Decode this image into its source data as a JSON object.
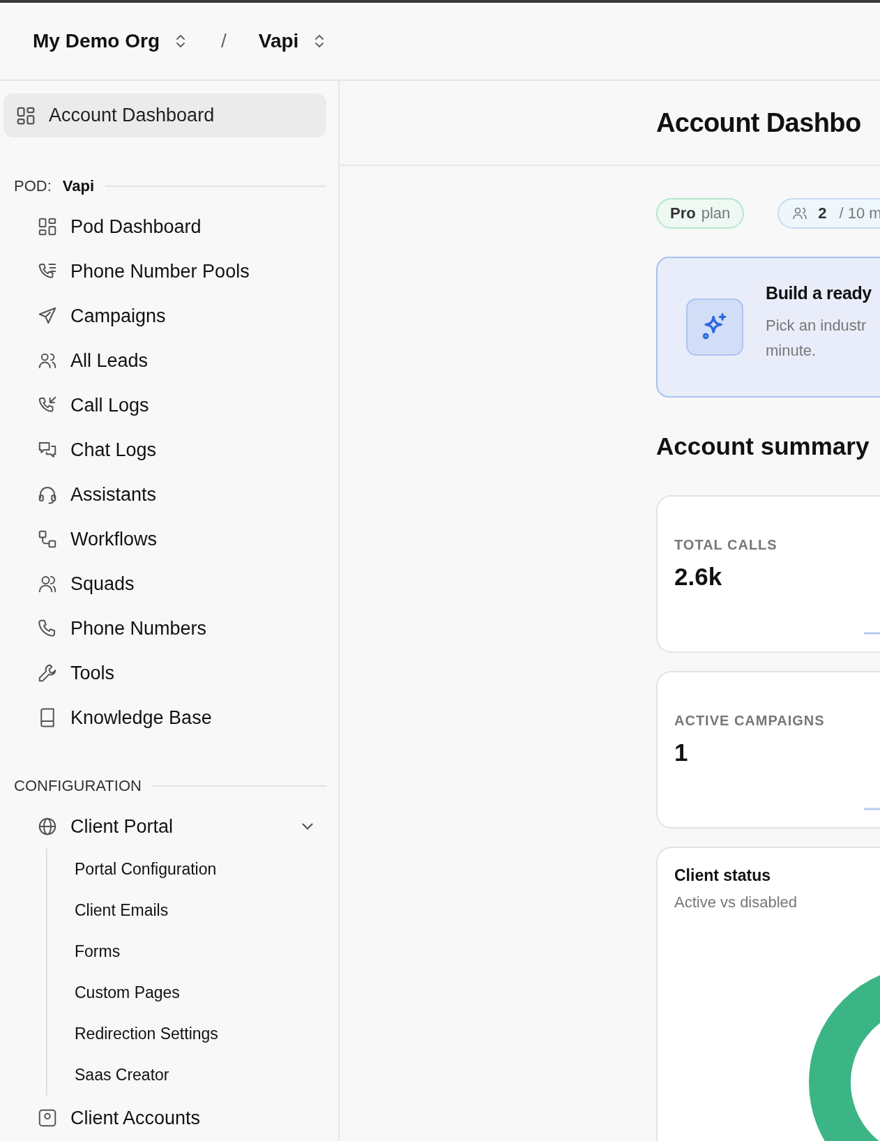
{
  "breadcrumb": {
    "org": "My Demo Org",
    "separator": "/",
    "project": "Vapi"
  },
  "sidebar": {
    "top_item": {
      "label": "Account Dashboard",
      "selected": true
    },
    "sections": [
      {
        "kind": "pod",
        "label": "POD:",
        "value": "Vapi",
        "items": [
          {
            "label": "Pod Dashboard",
            "selected": false
          },
          {
            "label": "Phone Number Pools",
            "selected": false
          },
          {
            "label": "Campaigns",
            "selected": false
          },
          {
            "label": "All Leads",
            "selected": false
          },
          {
            "label": "Call Logs",
            "selected": false
          },
          {
            "label": "Chat Logs",
            "selected": false
          },
          {
            "label": "Assistants",
            "selected": false
          },
          {
            "label": "Workflows",
            "selected": false
          },
          {
            "label": "Squads",
            "selected": false
          },
          {
            "label": "Phone Numbers",
            "selected": false
          },
          {
            "label": "Tools",
            "selected": false
          },
          {
            "label": "Knowledge Base",
            "selected": false
          }
        ]
      },
      {
        "kind": "plain",
        "label": "CONFIGURATION",
        "items": [
          {
            "label": "Client Portal",
            "selected": false,
            "expanded": true,
            "children": [
              {
                "label": "Portal Configuration",
                "selected": false
              },
              {
                "label": "Client Emails",
                "selected": false
              },
              {
                "label": "Forms",
                "selected": false
              },
              {
                "label": "Custom Pages",
                "selected": false
              },
              {
                "label": "Redirection Settings",
                "selected": false
              },
              {
                "label": "Saas Creator",
                "selected": false
              }
            ]
          },
          {
            "label": "Client Accounts",
            "selected": false
          }
        ]
      }
    ]
  },
  "main": {
    "title": "Account Dashbo",
    "plan_badge": {
      "strong": "Pro",
      "text": "plan"
    },
    "members_badge": {
      "count": "2",
      "text": "/ 10 m"
    },
    "banner": {
      "title": "Build a ready",
      "lines": [
        "Pick an industr",
        "minute."
      ]
    },
    "summary_heading": "Account summary",
    "stats": [
      {
        "label": "TOTAL CALLS",
        "value": "2.6k"
      },
      {
        "label": "ACTIVE CAMPAIGNS",
        "value": "1"
      }
    ],
    "client_status": {
      "title": "Client status",
      "subtitle": "Active vs disabled"
    }
  }
}
